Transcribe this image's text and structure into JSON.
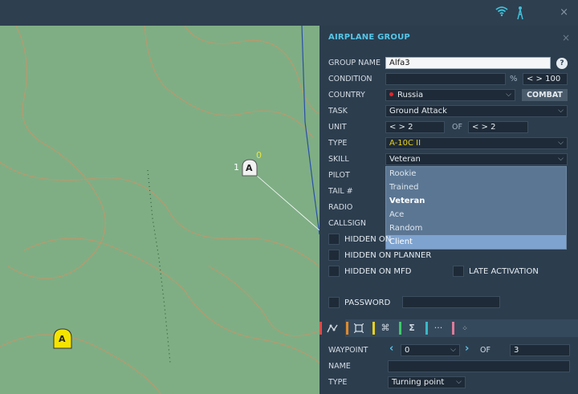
{
  "topbar": {
    "close": "×"
  },
  "panel": {
    "title": "AIRPLANE GROUP",
    "close": "×",
    "group_name": {
      "label": "GROUP NAME",
      "value": "Alfa3",
      "help": "?"
    },
    "condition": {
      "label": "CONDITION",
      "value": "",
      "percent": "%",
      "stepper": "< > 100"
    },
    "country": {
      "label": "COUNTRY",
      "value": "Russia",
      "flag_color": "#e3242b",
      "combat": "COMBAT"
    },
    "task": {
      "label": "TASK",
      "value": "Ground Attack"
    },
    "unit": {
      "label": "UNIT",
      "value": "< > 2",
      "of": "OF",
      "total": "< > 2"
    },
    "type": {
      "label": "TYPE",
      "value": "A-10C II",
      "color": "#e8d21c"
    },
    "skill": {
      "label": "SKILL",
      "value": "Veteran",
      "options": [
        "Rookie",
        "Trained",
        "Veteran",
        "Ace",
        "Random",
        "Client"
      ]
    },
    "pilot": {
      "label": "PILOT"
    },
    "tail": {
      "label": "TAIL #"
    },
    "radio": {
      "label": "RADIO"
    },
    "callsign": {
      "label": "CALLSIGN"
    },
    "checks": {
      "hidden_on_map": "HIDDEN ON",
      "hidden_on_planner": "HIDDEN ON PLANNER",
      "hidden_on_mfd": "HIDDEN ON MFD",
      "late_activation": "LATE ACTIVATION",
      "password": "PASSWORD"
    },
    "tabs": {
      "colors": [
        "#e04a4a",
        "#e08a2a",
        "#e8d21c",
        "#3fc86a",
        "#3ab7c8",
        "#e07a9a"
      ]
    },
    "waypoint": {
      "label": "WAYPOINT",
      "value": "0",
      "of": "OF",
      "total": "3"
    },
    "name": {
      "label": "NAME",
      "value": ""
    },
    "wp_type": {
      "label": "TYPE",
      "value": "Turning point"
    }
  },
  "map": {
    "unit_marker": {
      "letter": "A",
      "left_number": "1",
      "top_number": "0"
    },
    "yellow_marker": {
      "letter": "A"
    }
  }
}
